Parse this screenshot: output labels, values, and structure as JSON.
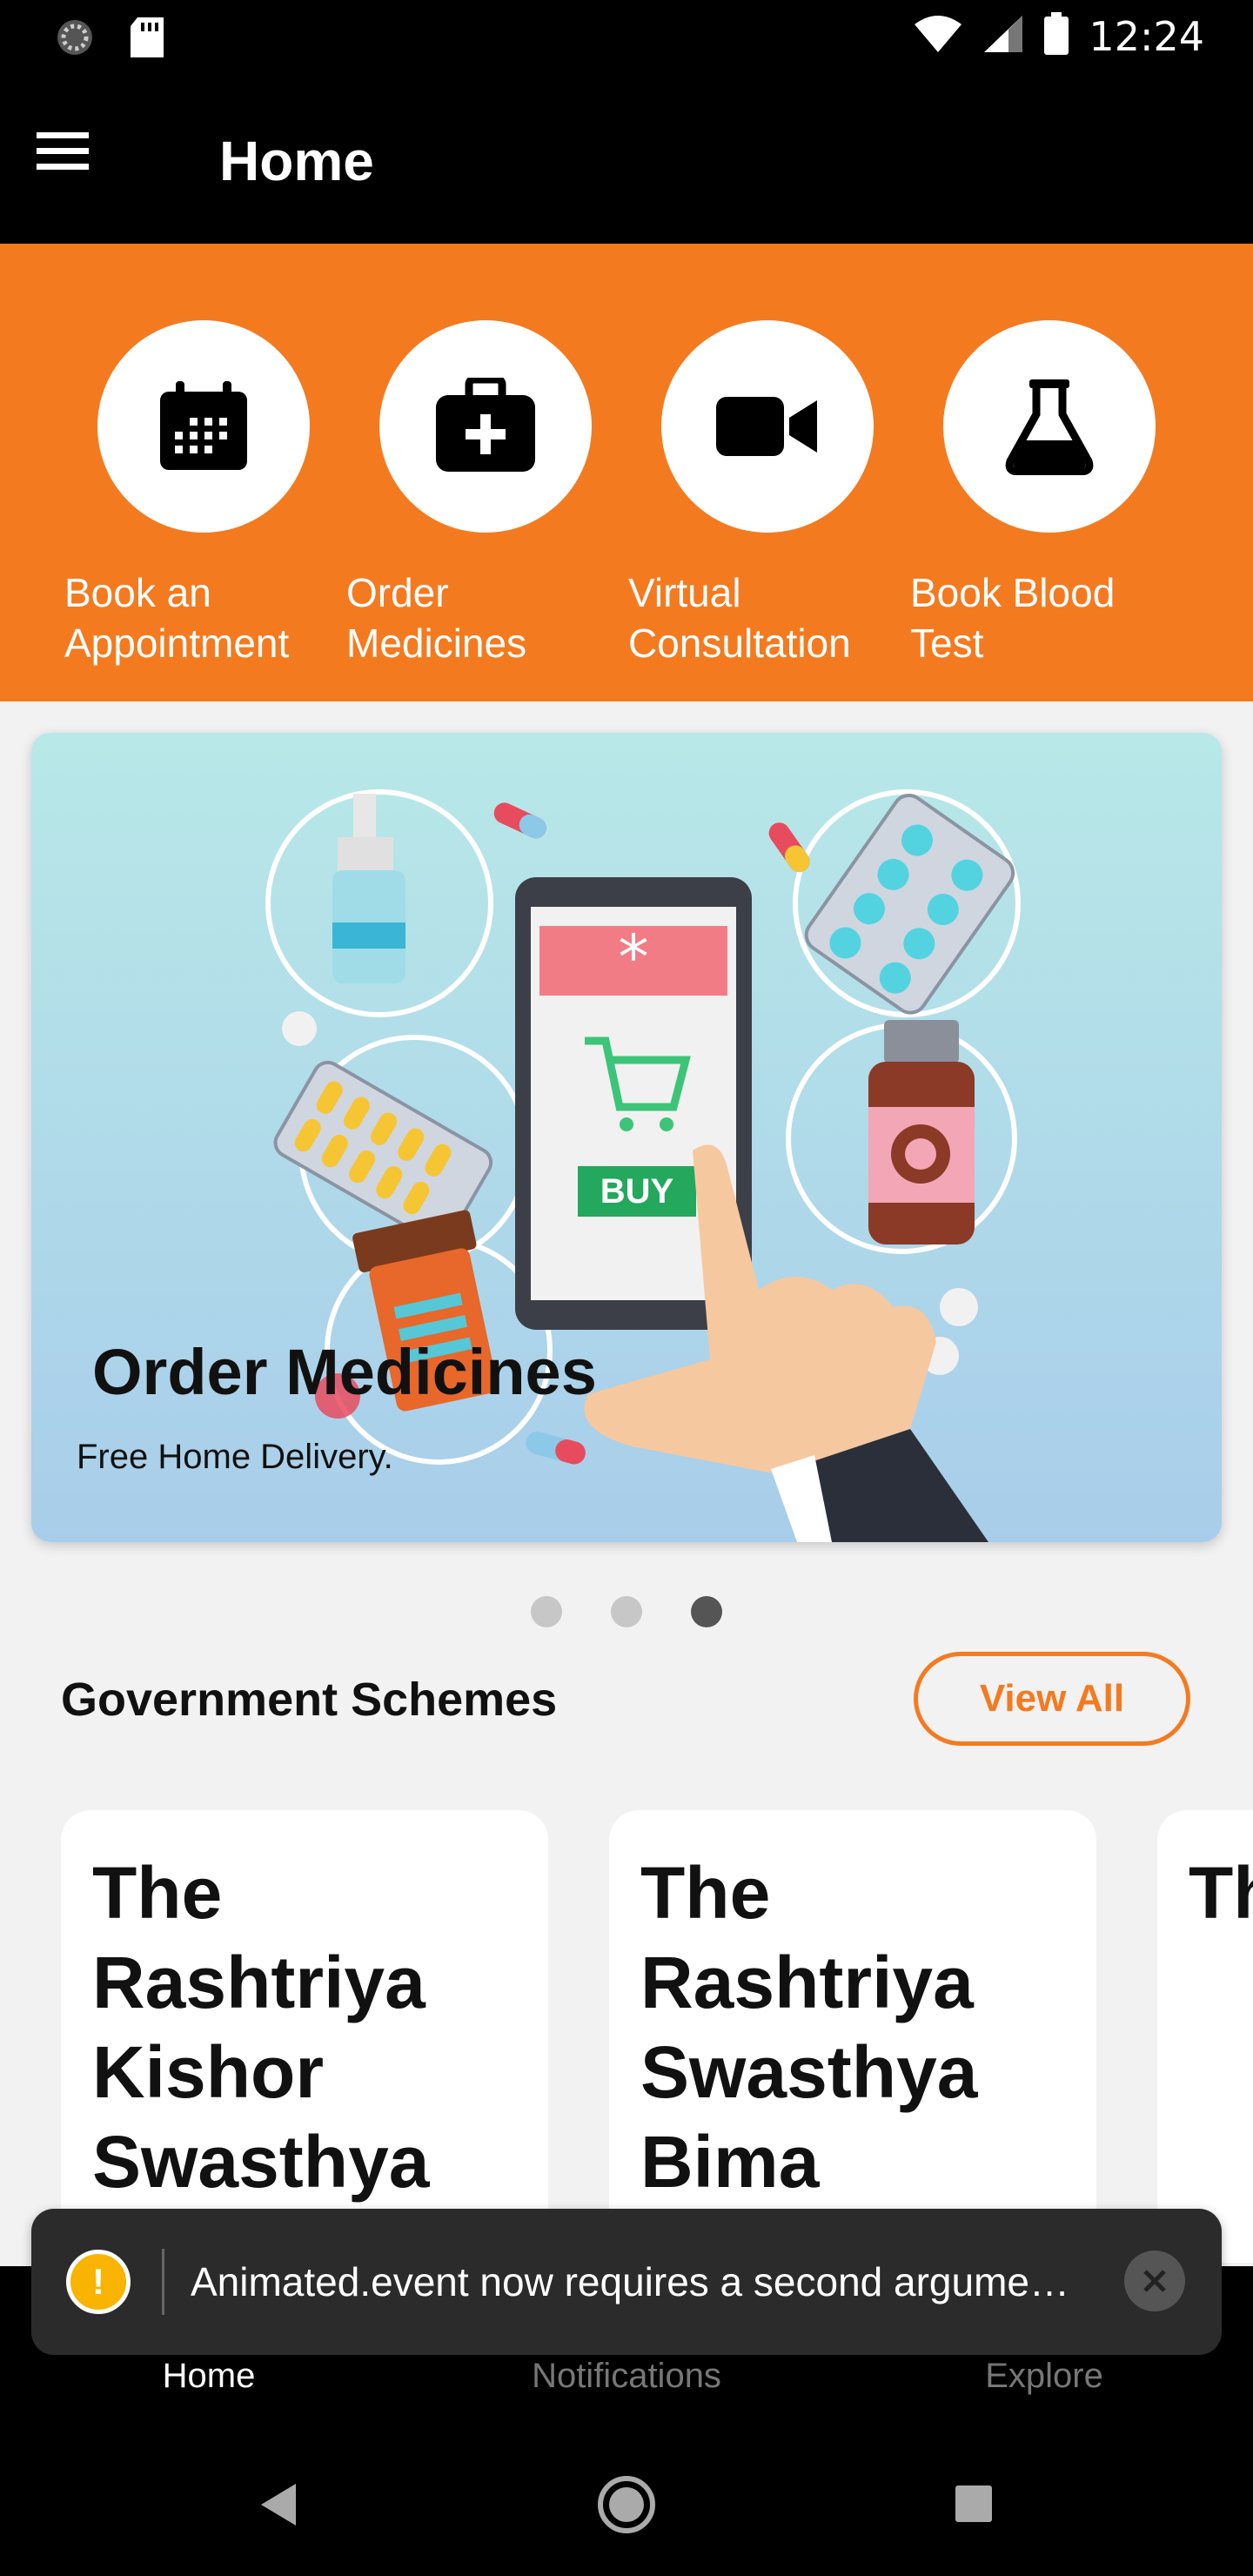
{
  "status_bar": {
    "time": "12:24"
  },
  "app_bar": {
    "title": "Home"
  },
  "quick_actions": [
    {
      "label": "Book an\nAppointment",
      "icon": "calendar-icon"
    },
    {
      "label": "Order\nMedicines",
      "icon": "medical-kit-icon"
    },
    {
      "label": "Virtual\nConsultation",
      "icon": "video-camera-icon"
    },
    {
      "label": "Book Blood\nTest",
      "icon": "flask-icon"
    }
  ],
  "banner": {
    "title": "Order Medicines",
    "subtitle": "Free Home Delivery.",
    "buy_label": "BUY",
    "active_index": 2,
    "dot_count": 3
  },
  "schemes": {
    "title": "Government Schemes",
    "view_all": "View All",
    "cards": [
      {
        "text": "The Rashtriya Kishor Swasthya"
      },
      {
        "text": "The Rashtriya Swasthya Bima"
      },
      {
        "text": "Th Ra Sv Bi Yo"
      }
    ]
  },
  "bottom_nav": {
    "home": "Home",
    "notifications": "Notifications",
    "explore": "Explore"
  },
  "toast": {
    "message": "Animated.event now requires a second argume…"
  },
  "colors": {
    "accent": "#f47a20",
    "app_bar": "#000000"
  }
}
